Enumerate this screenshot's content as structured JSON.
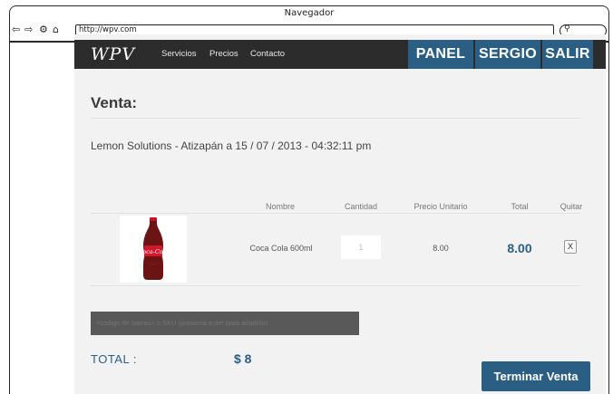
{
  "browser": {
    "title": "Navegador",
    "url": "http://wpv.com"
  },
  "nav": {
    "logo": "WPV",
    "links": [
      "Servicios",
      "Precios",
      "Contacto"
    ],
    "panel_label": "PANEL",
    "user_label": "SERGIO",
    "logout_label": "SALIR"
  },
  "sale": {
    "heading": "Venta:",
    "subtitle": "Lemon Solutions - Atizapán a 15 / 07 / 2013 - 04:32:11 pm"
  },
  "table": {
    "headers": [
      "Nombre",
      "Cantidad",
      "Precio Unitario",
      "Total",
      "Quitar"
    ],
    "rows": [
      {
        "name": "Coca Cola 600ml",
        "quantity": "1",
        "unit_price": "8.00",
        "total": "8.00",
        "remove_label": "X",
        "product_label": "Coca-Cola"
      }
    ]
  },
  "barcode": {
    "placeholder": "<código de barras> o SKU (presiona enter para añadirlo)"
  },
  "summary": {
    "total_label": "TOTAL :",
    "total_value": "$ 8",
    "finish_label": "Terminar Venta"
  },
  "colors": {
    "accent": "#2a5e82",
    "nav_bg": "#2c2c2c",
    "page_bg": "#f2f2f2",
    "input_dark": "#595959"
  },
  "icons": {
    "back": "back-arrow-icon",
    "forward": "forward-arrow-icon",
    "settings": "gear-icon",
    "home": "home-icon",
    "search": "search-icon"
  }
}
